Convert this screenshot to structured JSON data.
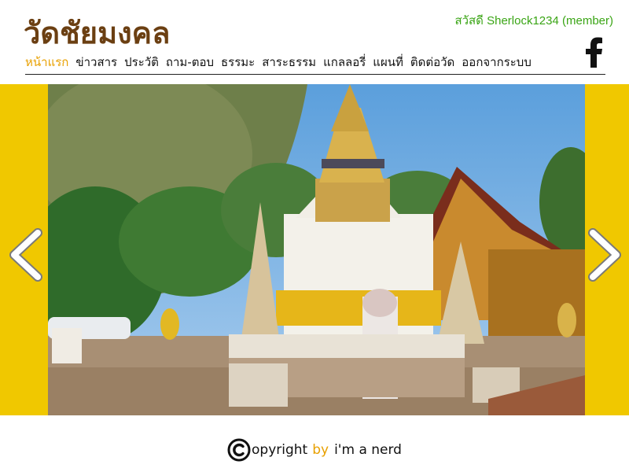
{
  "header": {
    "site_title": "วัดชัยมงคล",
    "greeting": "สวัสดี Sherlock1234 (member)"
  },
  "nav": {
    "items": [
      {
        "label": "หน้าแรก",
        "active": true
      },
      {
        "label": "ข่าวสาร"
      },
      {
        "label": "ประวัติ"
      },
      {
        "label": "ถาม-ตอบ"
      },
      {
        "label": "ธรรมะ"
      },
      {
        "label": "สาระธรรม"
      },
      {
        "label": "แกลลอรี่"
      },
      {
        "label": "แผนที่"
      },
      {
        "label": "ติดต่อวัด"
      },
      {
        "label": "ออกจากระบบ"
      }
    ]
  },
  "banner": {
    "prev_icon": "chevron-left-icon",
    "next_icon": "chevron-right-icon",
    "photo_subject": "temple-stupa-photo"
  },
  "social": {
    "icon": "facebook-icon"
  },
  "footer": {
    "copyright_text": "opyright",
    "by_text": "by",
    "author": "i'm a nerd"
  },
  "colors": {
    "title": "#6b3f12",
    "greeting": "#3aa515",
    "active_nav": "#e8a000",
    "banner_bg": "#f0c800"
  }
}
